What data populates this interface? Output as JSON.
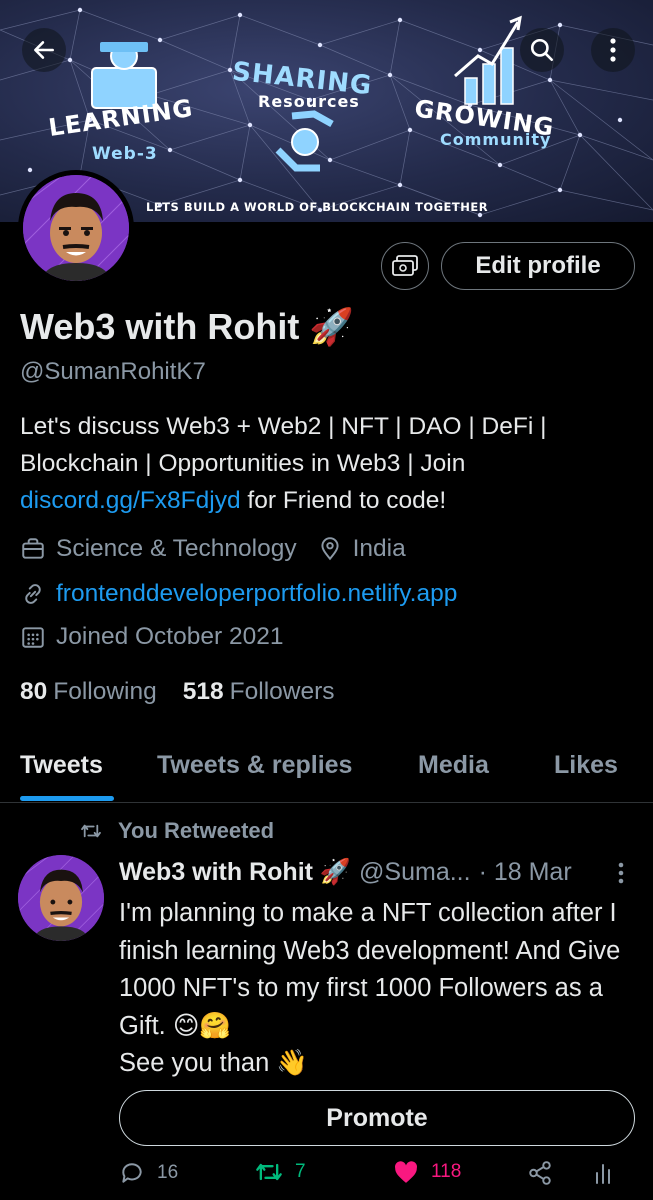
{
  "banner": {
    "word_left": "LEARNING",
    "word_left_sub": "Web-3",
    "word_center": "SHARING",
    "word_center_sub": "Resources",
    "word_right": "GROWING",
    "word_right_sub": "Community",
    "tagline": "LETS BUILD A WORLD OF BLOCKCHAIN TOGETHER"
  },
  "profile": {
    "edit_label": "Edit profile",
    "name": "Web3 with Rohit 🚀",
    "handle": "@SumanRohitK7",
    "bio_part1": "Let's discuss Web3 + Web2 | NFT | DAO | DeFi | Blockchain | Opportunities in Web3 | Join ",
    "bio_link": "discord.gg/Fx8Fdjyd",
    "bio_part2": " for Friend to code!",
    "category": "Science & Technology",
    "location": "India",
    "website": "frontenddeveloperportfolio.netlify.app",
    "joined": "Joined October 2021",
    "following_count": "80",
    "following_label": "Following",
    "followers_count": "518",
    "followers_label": "Followers"
  },
  "tabs": [
    "Tweets",
    "Tweets & replies",
    "Media",
    "Likes"
  ],
  "tweet": {
    "retweeted_label": "You Retweeted",
    "author_name": "Web3 with Rohit 🚀",
    "author_handle": "@Suma...",
    "date": "· 18 Mar",
    "text_line1": "I'm planning to make a NFT collection after I finish learning Web3 development! And Give 1000 NFT's to my first 1000 Followers as a Gift. 😊🤗",
    "text_line2": "See you than 👋",
    "promote_label": "Promote",
    "replies": "16",
    "retweets": "7",
    "likes": "118"
  },
  "colors": {
    "accent": "#1d9bf0",
    "retweet": "#00ba7c",
    "like": "#f91880"
  }
}
